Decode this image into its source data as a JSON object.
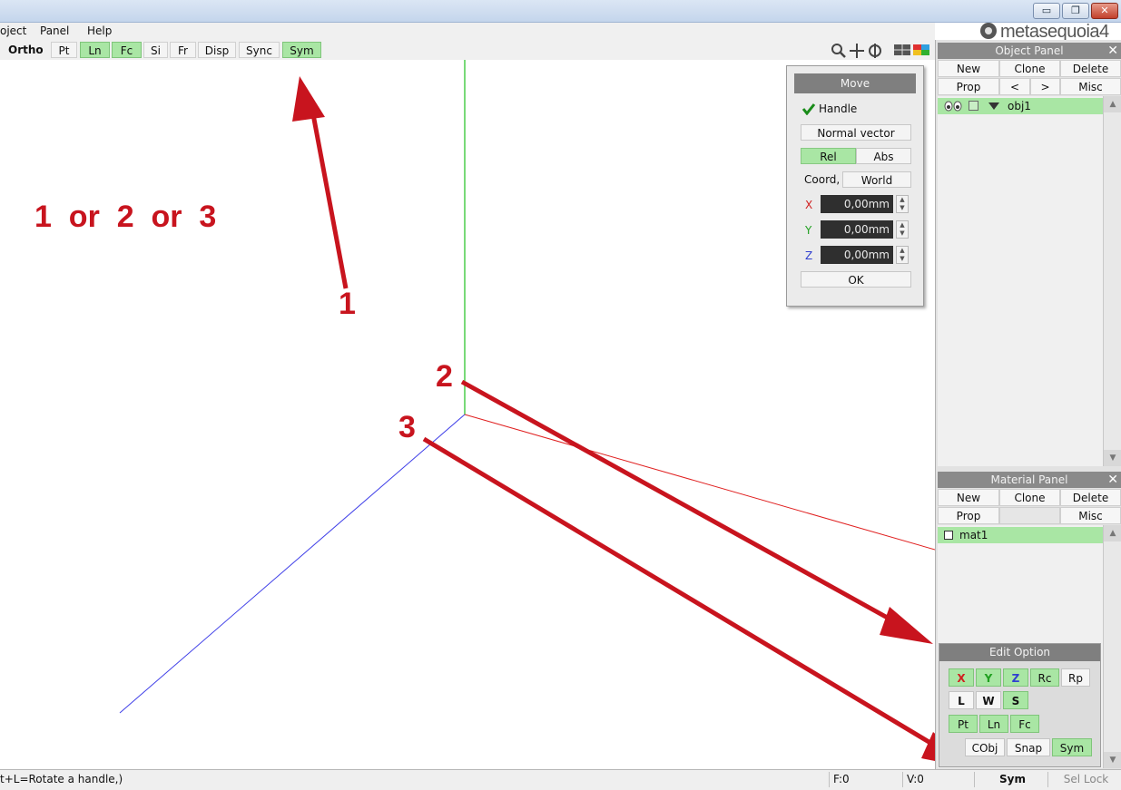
{
  "window": {
    "minimize_glyph": "▭",
    "restore_glyph": "❐",
    "close_glyph": "✕"
  },
  "brand": {
    "logo_text": "metasequoia4"
  },
  "menu": [
    "oject",
    "Panel",
    "Help"
  ],
  "toolbar": {
    "view_mode": "Ortho",
    "buttons": [
      {
        "label": "Pt",
        "active": false
      },
      {
        "label": "Ln",
        "active": true
      },
      {
        "label": "Fc",
        "active": true
      },
      {
        "label": "Si",
        "active": false
      },
      {
        "label": "Fr",
        "active": false
      },
      {
        "label": "Disp",
        "active": false
      },
      {
        "label": "Sync",
        "active": false
      },
      {
        "label": "Sym",
        "active": true
      }
    ],
    "view_icons": [
      "zoom-icon",
      "pan-icon",
      "rotate-icon",
      "view-layout-icon",
      "color-palette-icon"
    ]
  },
  "viewport": {
    "axis_colors": {
      "x": "#e02020",
      "y": "#20c020",
      "z": "#4040e8"
    }
  },
  "annotations": {
    "headline": "1  or  2  or  3",
    "labels": [
      "1",
      "2",
      "3"
    ],
    "arrow_color": "#c8141e"
  },
  "move_panel": {
    "title": "Move",
    "handle_label": "Handle",
    "handle_checked": true,
    "normal_vector": "Normal vector",
    "rel": "Rel",
    "abs": "Abs",
    "coord_label": "Coord,",
    "coord_value": "World",
    "axes": [
      {
        "name": "X",
        "value": "0,00mm",
        "color": "#d02020"
      },
      {
        "name": "Y",
        "value": "0,00mm",
        "color": "#20a020"
      },
      {
        "name": "Z",
        "value": "0,00mm",
        "color": "#3040d0"
      }
    ],
    "ok": "OK"
  },
  "object_panel": {
    "title": "Object Panel",
    "close_glyph": "✕",
    "row1": [
      "New",
      "Clone",
      "Delete"
    ],
    "row2": {
      "prop": "Prop",
      "prev": "<",
      "next": ">",
      "misc": "Misc"
    },
    "objects": [
      {
        "name": "obj1"
      }
    ]
  },
  "material_panel": {
    "title": "Material Panel",
    "close_glyph": "✕",
    "row1": [
      "New",
      "Clone",
      "Delete"
    ],
    "row2": {
      "prop": "Prop",
      "misc": "Misc"
    },
    "materials": [
      {
        "name": "mat1"
      }
    ]
  },
  "edit_option": {
    "title": "Edit Option",
    "row1": [
      {
        "label": "X",
        "active": true,
        "color": "#d02020"
      },
      {
        "label": "Y",
        "active": true,
        "color": "#20a020"
      },
      {
        "label": "Z",
        "active": true,
        "color": "#3040d0"
      },
      {
        "label": "Rc",
        "active": true,
        "color": "#111111"
      },
      {
        "label": "Rp",
        "active": false,
        "color": "#111111"
      }
    ],
    "row2": [
      {
        "label": "L",
        "active": false
      },
      {
        "label": "W",
        "active": false
      },
      {
        "label": "S",
        "active": true
      }
    ],
    "row3": [
      {
        "label": "Pt",
        "active": true
      },
      {
        "label": "Ln",
        "active": true
      },
      {
        "label": "Fc",
        "active": true
      }
    ],
    "row4": [
      {
        "label": "CObj",
        "active": false
      },
      {
        "label": "Snap",
        "active": false
      },
      {
        "label": "Sym",
        "active": true
      }
    ]
  },
  "statusbar": {
    "hint": "t+L=Rotate a handle,)",
    "faces": "F:0",
    "vertices": "V:0",
    "sym": "Sym",
    "sel_lock": "Sel Lock"
  }
}
